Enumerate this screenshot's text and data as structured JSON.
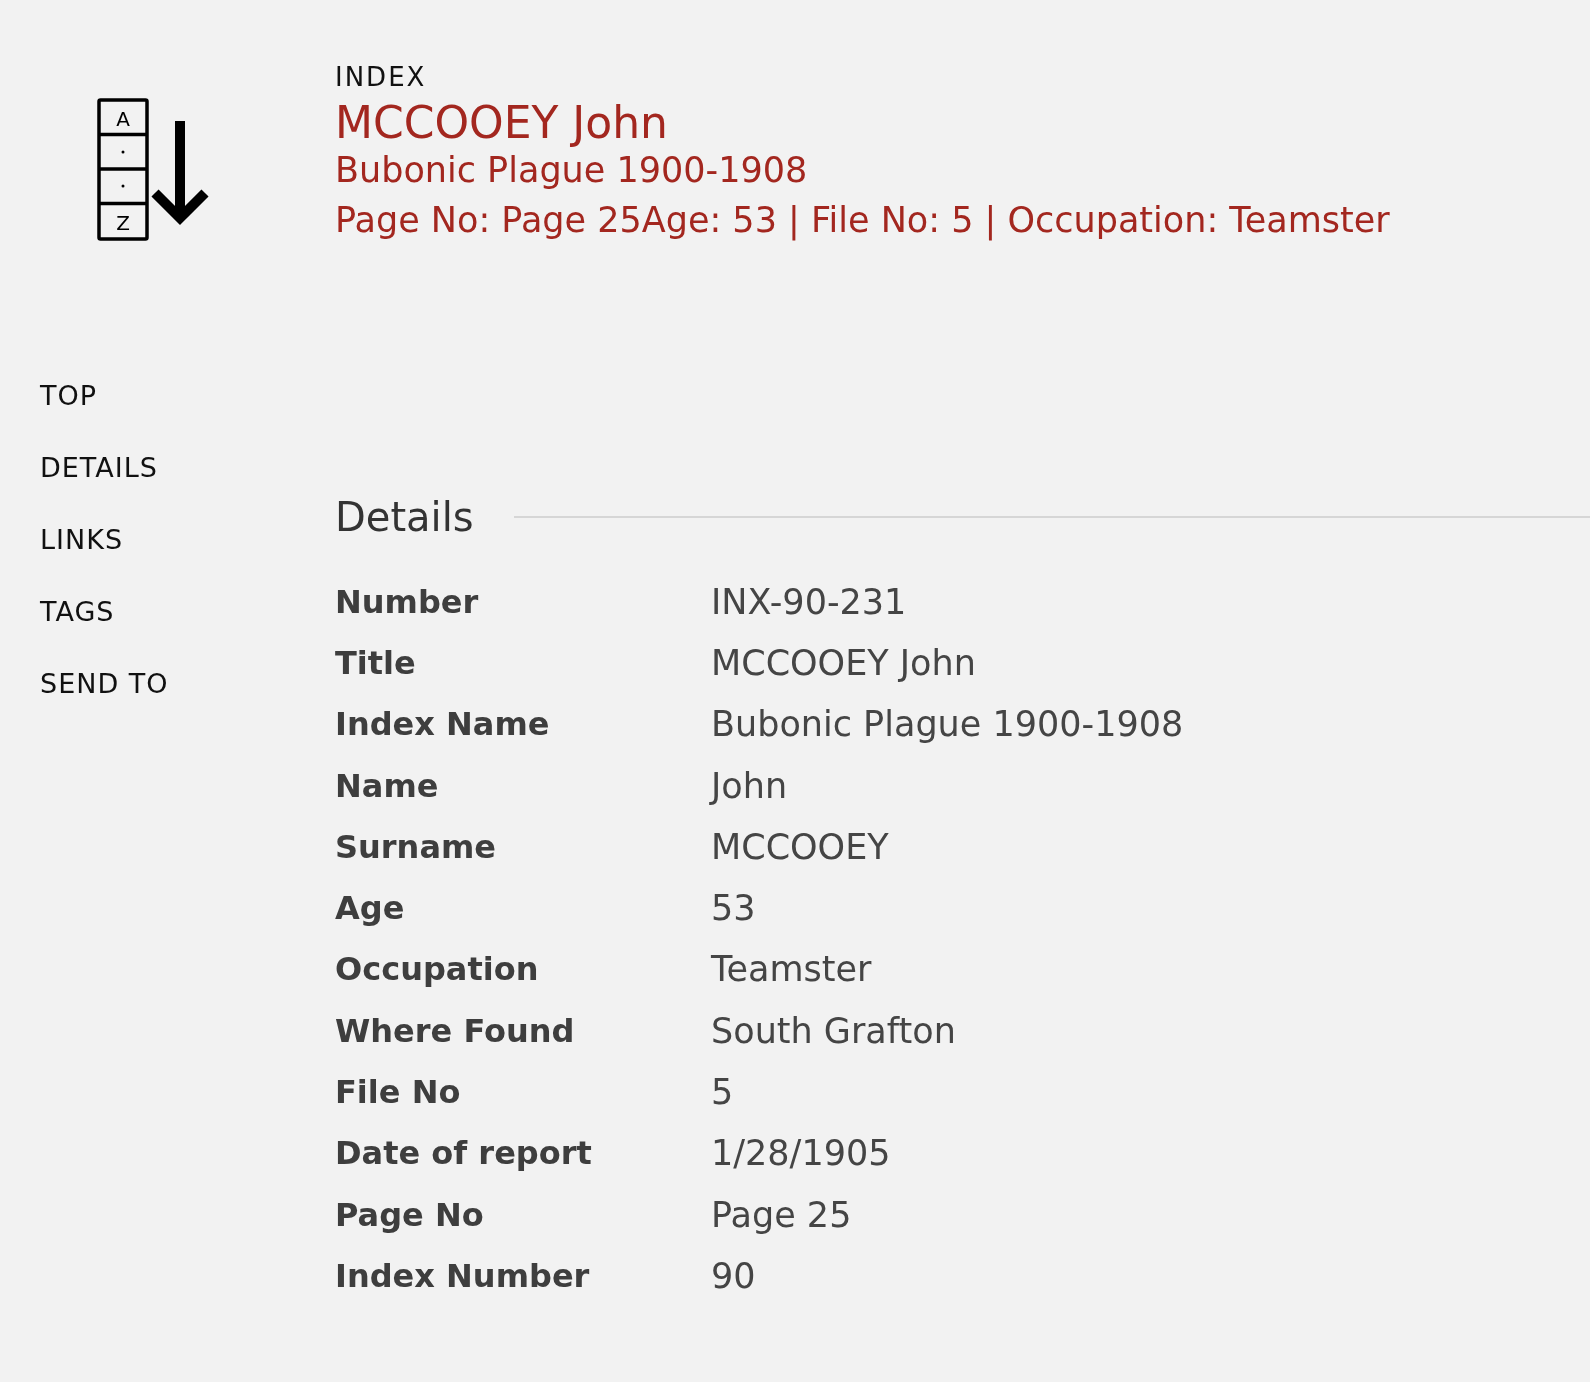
{
  "header": {
    "icon": {
      "top_letter": "A",
      "bottom_letter": "Z"
    },
    "kicker": "INDEX",
    "title": "MCCOOEY John",
    "subtitle": "Bubonic Plague 1900-1908",
    "summary": "Page No: Page 25Age: 53 | File No: 5 | Occupation: Teamster"
  },
  "nav": {
    "items": [
      {
        "label": "TOP"
      },
      {
        "label": "DETAILS"
      },
      {
        "label": "LINKS"
      },
      {
        "label": "TAGS"
      },
      {
        "label": "SEND TO"
      }
    ]
  },
  "details": {
    "heading": "Details",
    "rows": [
      {
        "label": "Number",
        "value": "INX-90-231"
      },
      {
        "label": "Title",
        "value": "MCCOOEY John"
      },
      {
        "label": "Index Name",
        "value": "Bubonic Plague 1900-1908"
      },
      {
        "label": "Name",
        "value": "John"
      },
      {
        "label": "Surname",
        "value": "MCCOOEY"
      },
      {
        "label": "Age",
        "value": "53"
      },
      {
        "label": "Occupation",
        "value": "Teamster"
      },
      {
        "label": "Where Found",
        "value": "South Grafton"
      },
      {
        "label": "File No",
        "value": "5"
      },
      {
        "label": "Date of report",
        "value": "1/28/1905"
      },
      {
        "label": "Page No",
        "value": "Page 25"
      },
      {
        "label": "Index Number",
        "value": "90"
      }
    ]
  }
}
